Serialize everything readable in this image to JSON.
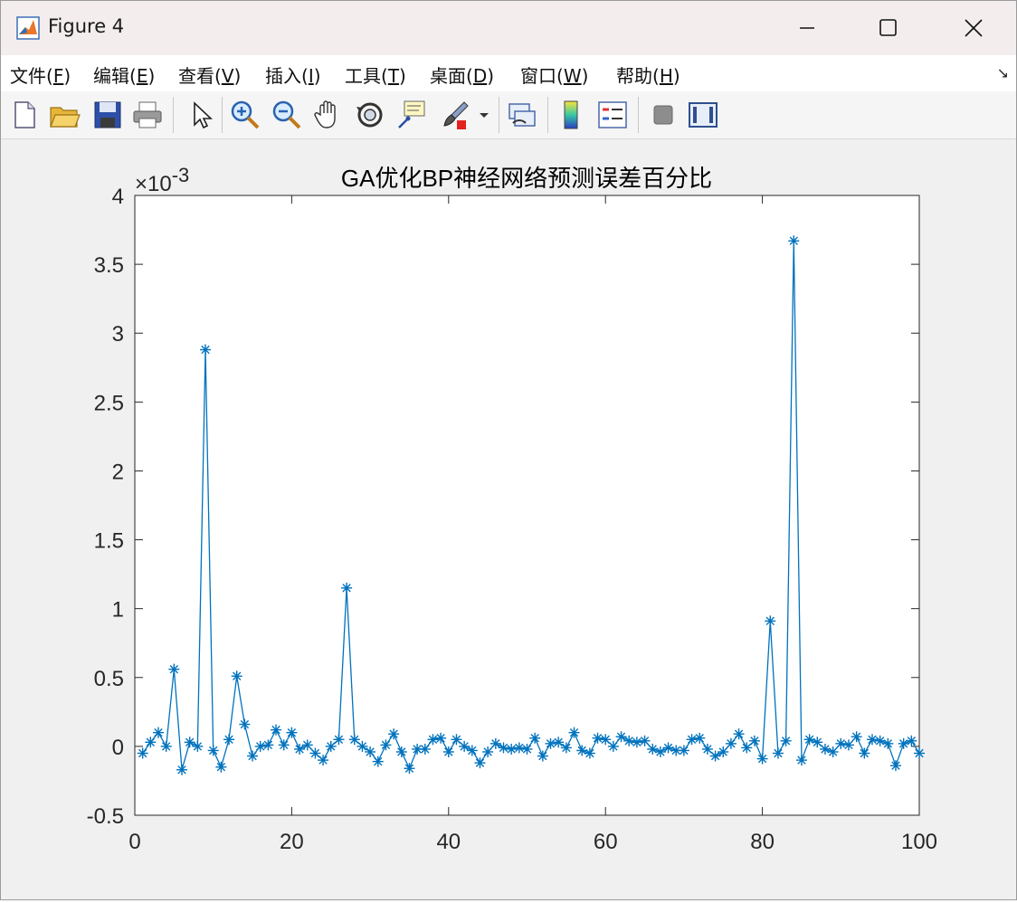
{
  "window": {
    "title": "Figure 4",
    "minimize_icon": "minimize-icon",
    "maximize_icon": "maximize-icon",
    "close_icon": "close-icon"
  },
  "menu": {
    "items": [
      {
        "label": "文件(",
        "mnemonic": "F",
        "suffix": ")"
      },
      {
        "label": "编辑(",
        "mnemonic": "E",
        "suffix": ")"
      },
      {
        "label": "查看(",
        "mnemonic": "V",
        "suffix": ")"
      },
      {
        "label": "插入(",
        "mnemonic": "I",
        "suffix": ")"
      },
      {
        "label": "工具(",
        "mnemonic": "T",
        "suffix": ")"
      },
      {
        "label": "桌面(",
        "mnemonic": "D",
        "suffix": ")"
      },
      {
        "label": "窗口(",
        "mnemonic": "W",
        "suffix": ")"
      },
      {
        "label": "帮助(",
        "mnemonic": "H",
        "suffix": ")"
      }
    ],
    "overflow_arrow": "↘"
  },
  "toolbar": {
    "buttons": [
      "new-figure-icon",
      "open-file-icon",
      "save-icon",
      "print-icon",
      "select-pointer-icon",
      "zoom-in-icon",
      "zoom-out-icon",
      "pan-hand-icon",
      "rotate-3d-icon",
      "data-cursor-icon",
      "brush-icon",
      "link-plot-icon",
      "colorbar-icon",
      "legend-icon",
      "hide-plot-tools-icon",
      "show-plot-tools-icon"
    ]
  },
  "chart_data": {
    "type": "line",
    "title": "GA优化BP神经网络预测误差百分比",
    "exponent_label": "×10",
    "exponent_power": "-3",
    "xlabel": "",
    "ylabel": "",
    "xlim": [
      0,
      100
    ],
    "ylim": [
      -0.5,
      4
    ],
    "xticks": [
      0,
      20,
      40,
      60,
      80,
      100
    ],
    "yticks": [
      -0.5,
      0,
      0.5,
      1,
      1.5,
      2,
      2.5,
      3,
      3.5,
      4
    ],
    "ytick_labels": [
      "-0.5",
      "0",
      "0.5",
      "1",
      "1.5",
      "2",
      "2.5",
      "3",
      "3.5",
      "4"
    ],
    "marker": "asterisk",
    "color": "#0072BD",
    "grid": false,
    "x": [
      1,
      2,
      3,
      4,
      5,
      6,
      7,
      8,
      9,
      10,
      11,
      12,
      13,
      14,
      15,
      16,
      17,
      18,
      19,
      20,
      21,
      22,
      23,
      24,
      25,
      26,
      27,
      28,
      29,
      30,
      31,
      32,
      33,
      34,
      35,
      36,
      37,
      38,
      39,
      40,
      41,
      42,
      43,
      44,
      45,
      46,
      47,
      48,
      49,
      50,
      51,
      52,
      53,
      54,
      55,
      56,
      57,
      58,
      59,
      60,
      61,
      62,
      63,
      64,
      65,
      66,
      67,
      68,
      69,
      70,
      71,
      72,
      73,
      74,
      75,
      76,
      77,
      78,
      79,
      80,
      81,
      82,
      83,
      84,
      85,
      86,
      87,
      88,
      89,
      90,
      91,
      92,
      93,
      94,
      95,
      96,
      97,
      98,
      99,
      100
    ],
    "y": [
      -0.05,
      0.03,
      0.1,
      0.0,
      0.56,
      -0.17,
      0.03,
      0.0,
      2.88,
      -0.03,
      -0.15,
      0.05,
      0.51,
      0.16,
      -0.07,
      0.0,
      0.01,
      0.12,
      0.01,
      0.1,
      -0.02,
      0.01,
      -0.05,
      -0.1,
      0.0,
      0.05,
      1.15,
      0.05,
      0.0,
      -0.04,
      -0.11,
      0.01,
      0.09,
      -0.04,
      -0.16,
      -0.02,
      -0.02,
      0.05,
      0.06,
      -0.04,
      0.05,
      0.0,
      -0.03,
      -0.12,
      -0.04,
      0.02,
      -0.01,
      -0.02,
      -0.01,
      -0.02,
      0.06,
      -0.07,
      0.02,
      0.03,
      -0.01,
      0.1,
      -0.03,
      -0.05,
      0.06,
      0.05,
      0.0,
      0.07,
      0.04,
      0.03,
      0.04,
      -0.02,
      -0.04,
      -0.01,
      -0.03,
      -0.03,
      0.05,
      0.06,
      -0.02,
      -0.07,
      -0.04,
      0.02,
      0.09,
      -0.01,
      0.04,
      -0.09,
      0.91,
      -0.05,
      0.04,
      3.67,
      -0.1,
      0.05,
      0.03,
      -0.02,
      -0.04,
      0.02,
      0.01,
      0.07,
      -0.05,
      0.05,
      0.04,
      0.02,
      -0.14,
      0.02,
      0.04,
      -0.05
    ]
  }
}
